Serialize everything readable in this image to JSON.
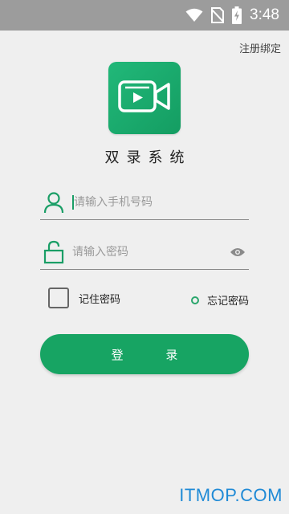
{
  "status_bar": {
    "time": "3:48",
    "icons": [
      "wifi-icon",
      "no-sim-icon",
      "battery-charging-icon"
    ]
  },
  "header": {
    "register_bind_label": "注册绑定"
  },
  "app": {
    "title": "双录系统",
    "logo_icon": "video-camera-icon",
    "brand_color": "#17a463"
  },
  "form": {
    "phone_placeholder": "请输入手机号码",
    "password_placeholder": "请输入密码",
    "remember_label": "记住密码",
    "forgot_label": "忘记密码",
    "login_label": "登 录",
    "icons": {
      "phone": "user-icon",
      "password": "lock-icon",
      "toggle": "eye-icon"
    }
  },
  "watermark": "ITMOP.COM"
}
